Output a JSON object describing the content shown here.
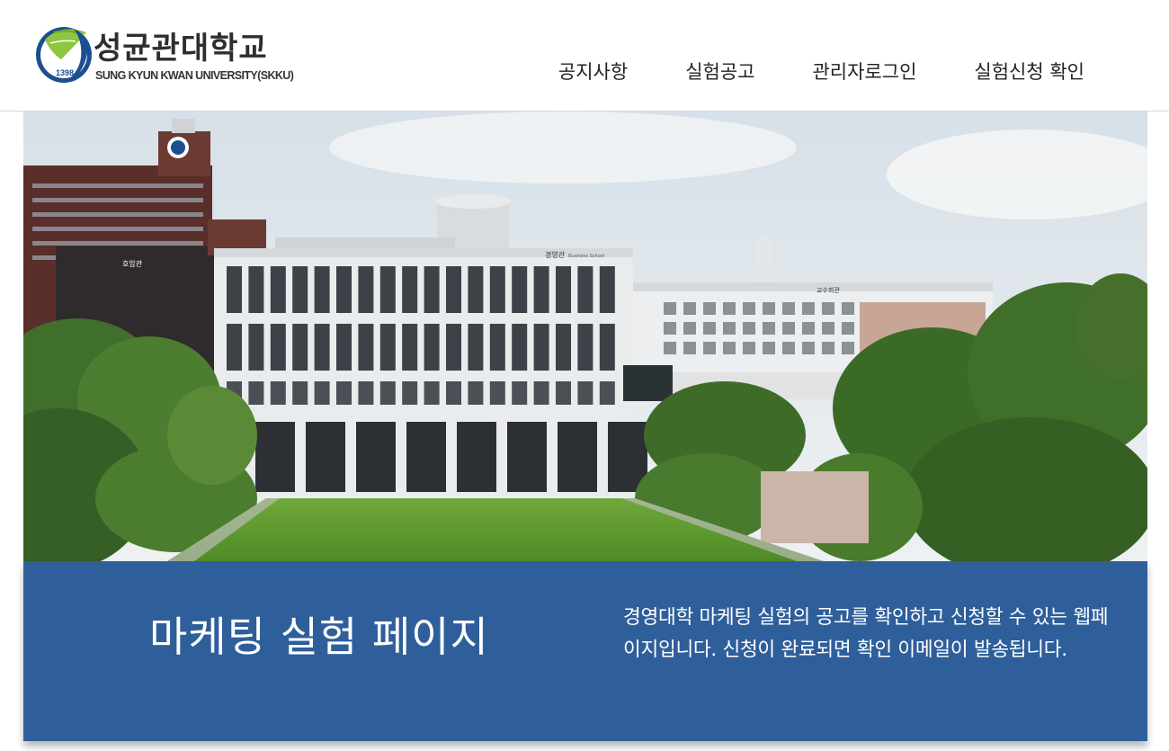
{
  "logo": {
    "name_ko": "성균관대학교",
    "name_en": "SUNG KYUN KWAN UNIVERSITY(SKKU)",
    "year": "1398",
    "colors": {
      "green": "#8dc63f",
      "blue": "#1b4f8f"
    }
  },
  "nav": {
    "items": [
      {
        "label": "공지사항"
      },
      {
        "label": "실험공고"
      },
      {
        "label": "관리자로그인"
      },
      {
        "label": "실험신청 확인"
      }
    ]
  },
  "hero": {
    "signs": {
      "main_building": "경영관",
      "main_building_en": "Business School",
      "left_building": "호암관",
      "right_building": "교수회관"
    }
  },
  "banner": {
    "title": "마케팅 실험 페이지",
    "description": "경영대학 마케팅 실험의 공고를 확인하고 신청할 수 있는 웹페이지입니다. 신청이 완료되면 확인 이메일이 발송됩니다.",
    "background": "#2f5f9b"
  }
}
